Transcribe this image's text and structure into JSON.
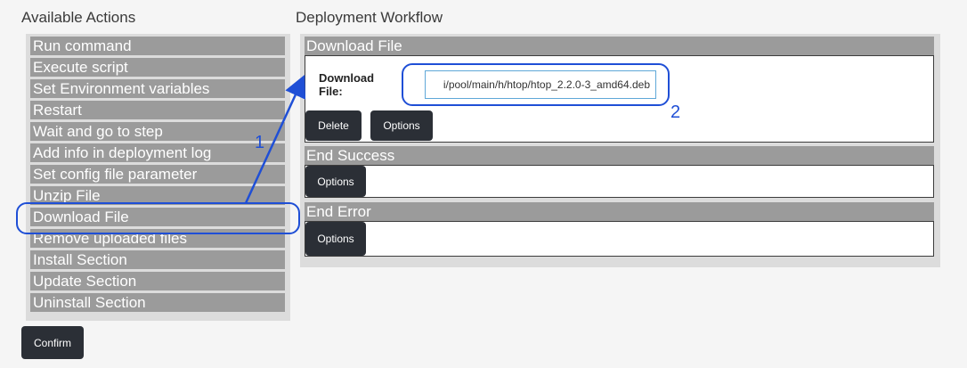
{
  "available_actions": {
    "heading": "Available Actions",
    "items": [
      "Run command",
      "Execute script",
      "Set Environment variables",
      "Restart",
      "Wait and go to step",
      "Add info in deployment log",
      "Set config file parameter",
      "Unzip File",
      "Download File",
      "Remove uploaded files",
      "Install Section",
      "Update Section",
      "Uninstall Section"
    ],
    "confirm_label": "Confirm"
  },
  "workflow": {
    "heading": "Deployment Workflow",
    "steps": [
      {
        "title": "Download File",
        "field_label": "Download File:",
        "field_value": "i/pool/main/h/htop/htop_2.2.0-3_amd64.deb",
        "delete_label": "Delete",
        "options_label": "Options"
      },
      {
        "title": "End Success",
        "options_label": "Options"
      },
      {
        "title": "End Error",
        "options_label": "Options"
      }
    ]
  },
  "annotations": {
    "label_1": "1",
    "label_2": "2",
    "color": "#1f4fd6"
  },
  "colors": {
    "item_bg": "#9b9b9b",
    "panel_bg": "#dcdcdc",
    "button_bg": "#2b2f36",
    "input_border": "#5fa8d8"
  }
}
